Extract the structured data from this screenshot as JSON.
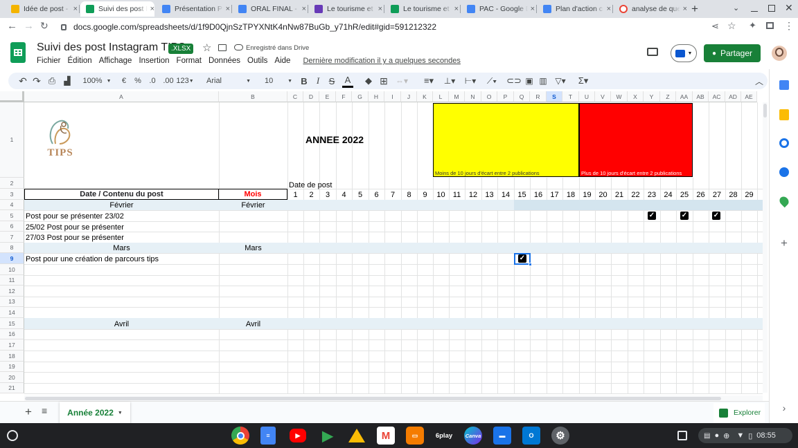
{
  "browser": {
    "tabs": [
      {
        "label": "Idée de post - G",
        "color": "#f4b400"
      },
      {
        "label": "Suivi des post I",
        "color": "#0f9d58"
      },
      {
        "label": "Présentation P",
        "color": "#4285f4"
      },
      {
        "label": "ORAL FINAL - G",
        "color": "#4285f4"
      },
      {
        "label": "Le tourisme et",
        "color": "#673ab7"
      },
      {
        "label": "Le tourisme et",
        "color": "#0f9d58"
      },
      {
        "label": "PAC - Google D",
        "color": "#4285f4"
      },
      {
        "label": "Plan d'action c",
        "color": "#4285f4"
      },
      {
        "label": "analyse de que",
        "color": "#ea4335"
      }
    ],
    "new_tab": "+",
    "url": "docs.google.com/spreadsheets/d/1f9D0QjnSzTPYXNtK4nNw87BuGb_y71hR/edit#gid=591212322"
  },
  "doc": {
    "title": "Suivi des post Instagram TIPS",
    "badge": ".XLSX",
    "saved": "Enregistré dans Drive",
    "last_modified": "Dernière modification il y a quelques secondes",
    "share": "Partager",
    "menu": [
      "Fichier",
      "Édition",
      "Affichage",
      "Insertion",
      "Format",
      "Données",
      "Outils",
      "Aide"
    ]
  },
  "toolbar": {
    "zoom": "100%",
    "currency": "€",
    "percent": "%",
    "dec_less": ".0",
    "dec_more": ".00",
    "num_format": "123",
    "font": "Arial",
    "size": "10"
  },
  "sheet": {
    "columns": [
      "A",
      "B",
      "C",
      "D",
      "E",
      "F",
      "G",
      "H",
      "I",
      "J",
      "K",
      "L",
      "M",
      "N",
      "O",
      "P",
      "Q",
      "R",
      "S",
      "T",
      "U",
      "V",
      "W",
      "X",
      "Y",
      "Z",
      "AA",
      "AB",
      "AC",
      "AD",
      "AE"
    ],
    "rows": [
      "1",
      "2",
      "3",
      "4",
      "5",
      "6",
      "7",
      "8",
      "9",
      "10",
      "11",
      "12",
      "13",
      "14",
      "15",
      "16",
      "17",
      "18",
      "19",
      "20",
      "21"
    ],
    "logo_text": "TIPS",
    "year_title": "ANNEE 2022",
    "legend_yellow": "Moins de 10 jours d'écart entre 2 publications",
    "legend_red": "Plus de 10 jours d'écart entre 2 publications",
    "date_de_post": "Date de post",
    "header_a": "Date / Contenu du post",
    "header_b": "Mois",
    "days": [
      "1",
      "2",
      "3",
      "4",
      "5",
      "6",
      "7",
      "8",
      "9",
      "10",
      "11",
      "12",
      "13",
      "14",
      "15",
      "16",
      "17",
      "18",
      "19",
      "20",
      "21",
      "22",
      "23",
      "24",
      "25",
      "26",
      "27",
      "28",
      "29"
    ],
    "fevrier_a": "Février",
    "fevrier_b": "Février",
    "post1": "Post pour se présenter 23/02",
    "post2": "25/02 Post pour se présenter",
    "post3": "27/03 Post pour se présenter",
    "mars_a": "Mars",
    "mars_b": "Mars",
    "post4": "Post pour une création de parcours tips",
    "avril_a": "Avril",
    "avril_b": "Avril"
  },
  "bottom": {
    "sheet_tab": "Année 2022",
    "explore": "Explorer"
  },
  "shelf": {
    "clock": "08:55",
    "sixplay": "6play",
    "canva": "Canva"
  }
}
